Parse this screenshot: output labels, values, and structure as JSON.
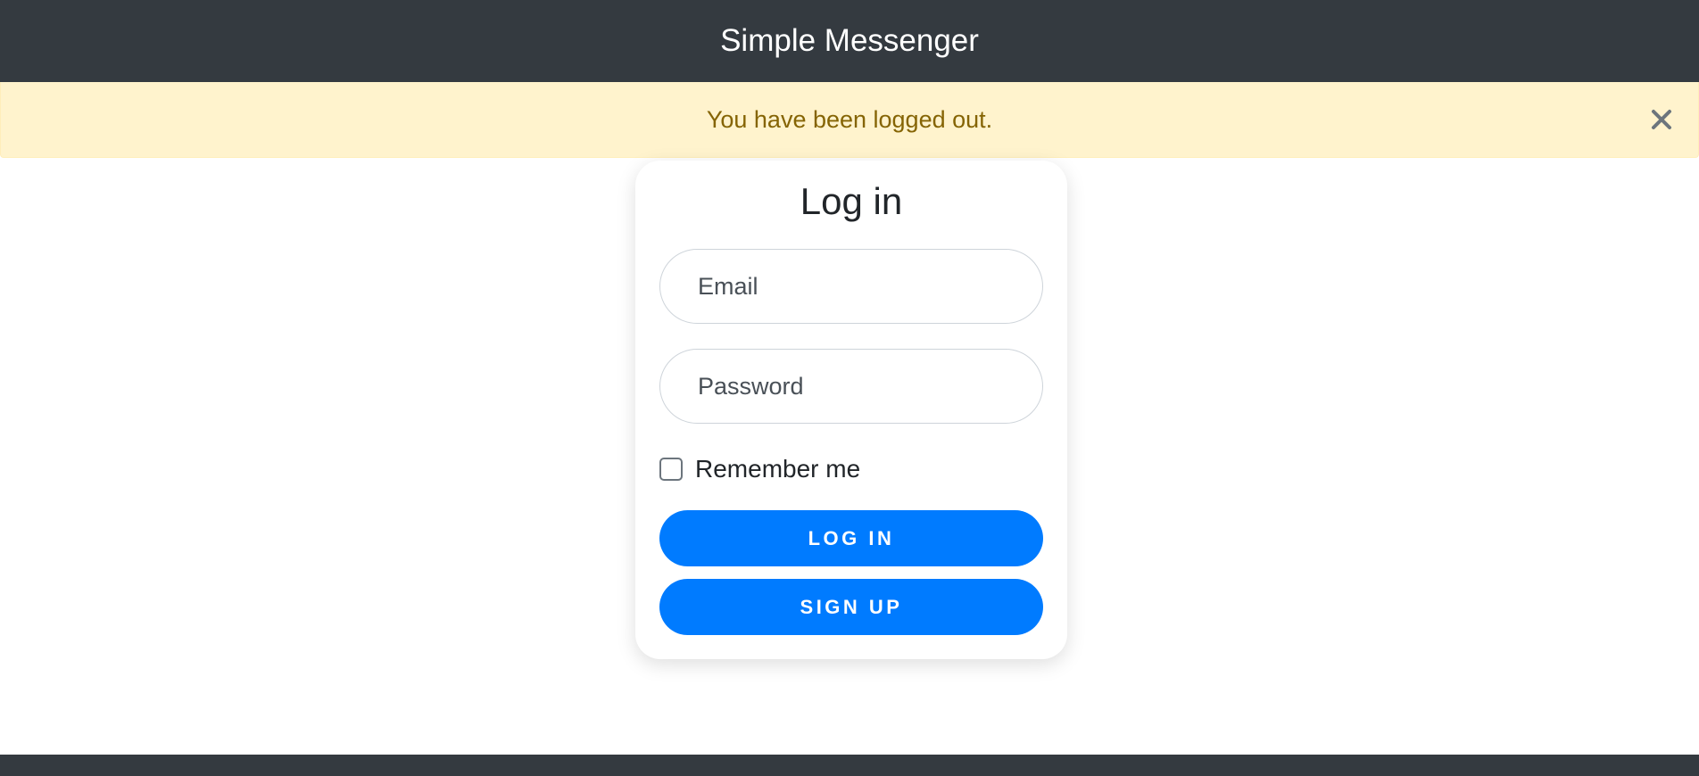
{
  "app": {
    "title": "Simple Messenger"
  },
  "alert": {
    "message": "You have been logged out.",
    "close_icon": "close-icon"
  },
  "login": {
    "title": "Log in",
    "email_placeholder": "Email",
    "password_placeholder": "Password",
    "remember_label": "Remember me",
    "remember_checked": false,
    "login_label": "LOG IN",
    "signup_label": "SIGN UP"
  },
  "colors": {
    "header_bg": "#343a40",
    "alert_bg": "#fff3cd",
    "alert_text": "#856404",
    "primary": "#007bff"
  }
}
